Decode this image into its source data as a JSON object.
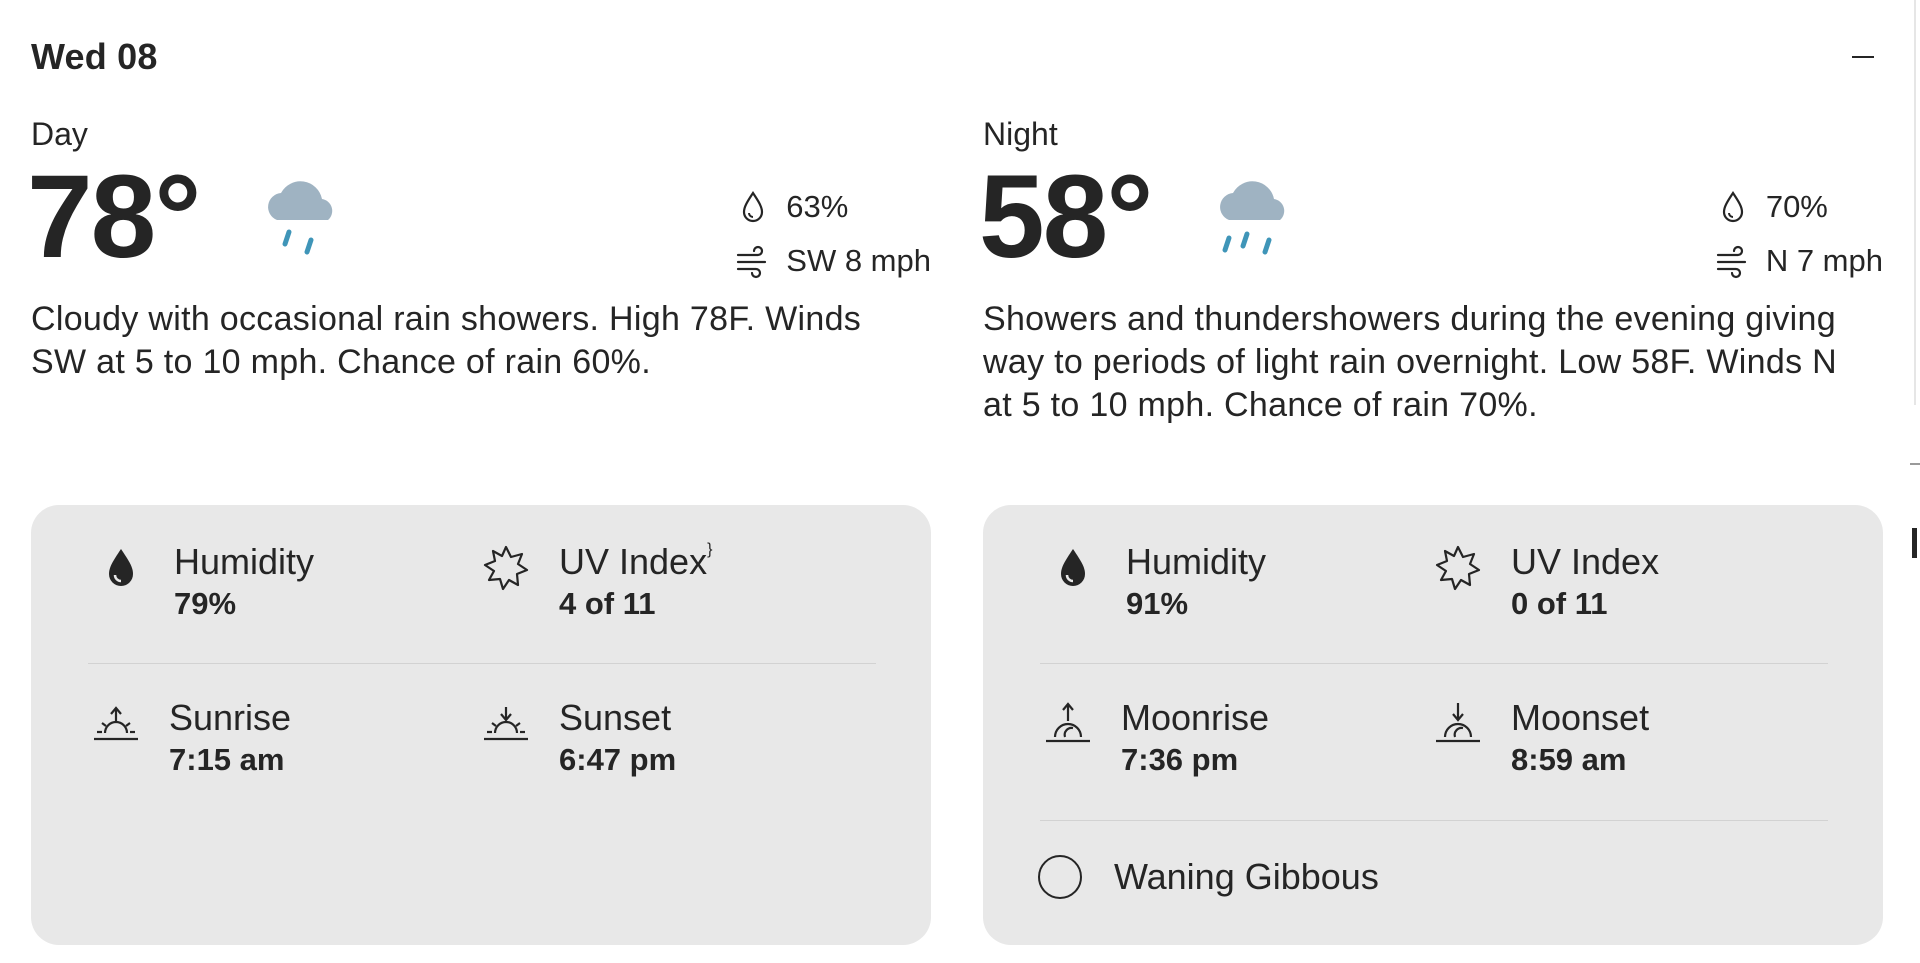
{
  "header": {
    "date_label": "Wed 08"
  },
  "day": {
    "label": "Day",
    "temperature": "78°",
    "icon": "rain-cloud-icon",
    "precip": "63%",
    "wind": "SW 8 mph",
    "narrative": "Cloudy with occasional rain showers. High 78F. Winds SW at 5 to 10 mph. Chance of rain 60%.",
    "details": {
      "humidity_label": "Humidity",
      "humidity_value": "79%",
      "uv_label": "UV Index",
      "uv_value": "4 of 11",
      "sunrise_label": "Sunrise",
      "sunrise_value": "7:15 am",
      "sunset_label": "Sunset",
      "sunset_value": "6:47 pm"
    }
  },
  "night": {
    "label": "Night",
    "temperature": "58°",
    "icon": "rain-cloud-icon",
    "precip": "70%",
    "wind": "N 7 mph",
    "narrative": "Showers and thundershowers during the evening giving way to periods of light rain overnight. Low 58F. Winds N at 5 to 10 mph. Chance of rain 70%.",
    "details": {
      "humidity_label": "Humidity",
      "humidity_value": "91%",
      "uv_label": "UV Index",
      "uv_value": "0 of 11",
      "moonrise_label": "Moonrise",
      "moonrise_value": "7:36 pm",
      "moonset_label": "Moonset",
      "moonset_value": "8:59 am",
      "moon_phase": "Waning Gibbous"
    }
  },
  "colors": {
    "text": "#252525",
    "card_bg": "#e8e8e8",
    "cloud": "#9fb3c2",
    "rain": "#3f95b8"
  }
}
